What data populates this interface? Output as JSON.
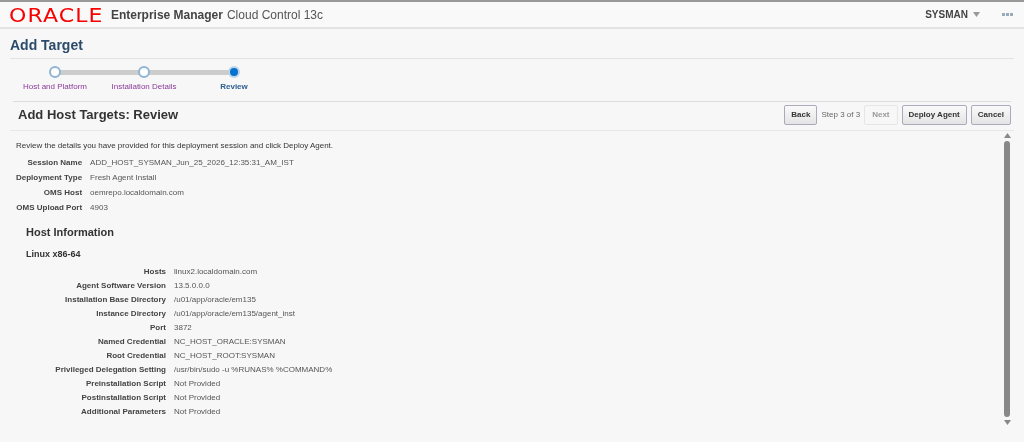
{
  "header": {
    "brand": "ORACLE",
    "product": "Enterprise Manager",
    "edition": "Cloud Control 13c",
    "user": "SYSMAN"
  },
  "page_title": "Add Target",
  "train": [
    {
      "label": "Host and Platform",
      "selected": false
    },
    {
      "label": "Installation Details",
      "selected": false
    },
    {
      "label": "Review",
      "selected": true
    }
  ],
  "section_title": "Add Host Targets: Review",
  "toolbar": [
    {
      "kind": "button",
      "label": "Back",
      "disabled": false
    },
    {
      "kind": "text",
      "label": "Step 3 of 3"
    },
    {
      "kind": "button",
      "label": "Next",
      "disabled": true
    },
    {
      "kind": "button",
      "label": "Deploy Agent",
      "disabled": false
    },
    {
      "kind": "button",
      "label": "Cancel",
      "disabled": false
    }
  ],
  "instruction": "Review the details you have provided for this deployment session and click Deploy Agent.",
  "session_fields": [
    {
      "label": "Session Name",
      "value": "ADD_HOST_SYSMAN_Jun_25_2026_12:35:31_AM_IST"
    },
    {
      "label": "Deployment Type",
      "value": "Fresh Agent Install"
    },
    {
      "label": "OMS Host",
      "value": "oemrepo.localdomain.com"
    },
    {
      "label": "OMS Upload Port",
      "value": "4903"
    }
  ],
  "host_information": {
    "title": "Host Information",
    "platform": "Linux x86-64",
    "fields": [
      {
        "label": "Hosts",
        "value": "linux2.localdomain.com"
      },
      {
        "label": "Agent Software Version",
        "value": "13.5.0.0.0"
      },
      {
        "label": "Installation Base Directory",
        "value": "/u01/app/oracle/em135"
      },
      {
        "label": "Instance Directory",
        "value": "/u01/app/oracle/em135/agent_inst"
      },
      {
        "label": "Port",
        "value": "3872"
      },
      {
        "label": "Named Credential",
        "value": "NC_HOST_ORACLE:SYSMAN"
      },
      {
        "label": "Root Credential",
        "value": "NC_HOST_ROOT:SYSMAN"
      },
      {
        "label": "Privileged Delegation Setting",
        "value": "/usr/bin/sudo -u %RUNAS% %COMMAND%"
      },
      {
        "label": "Preinstallation Script",
        "value": "Not Provided"
      },
      {
        "label": "Postinstallation Script",
        "value": "Not Provided"
      },
      {
        "label": "Additional Parameters",
        "value": "Not Provided"
      }
    ]
  }
}
